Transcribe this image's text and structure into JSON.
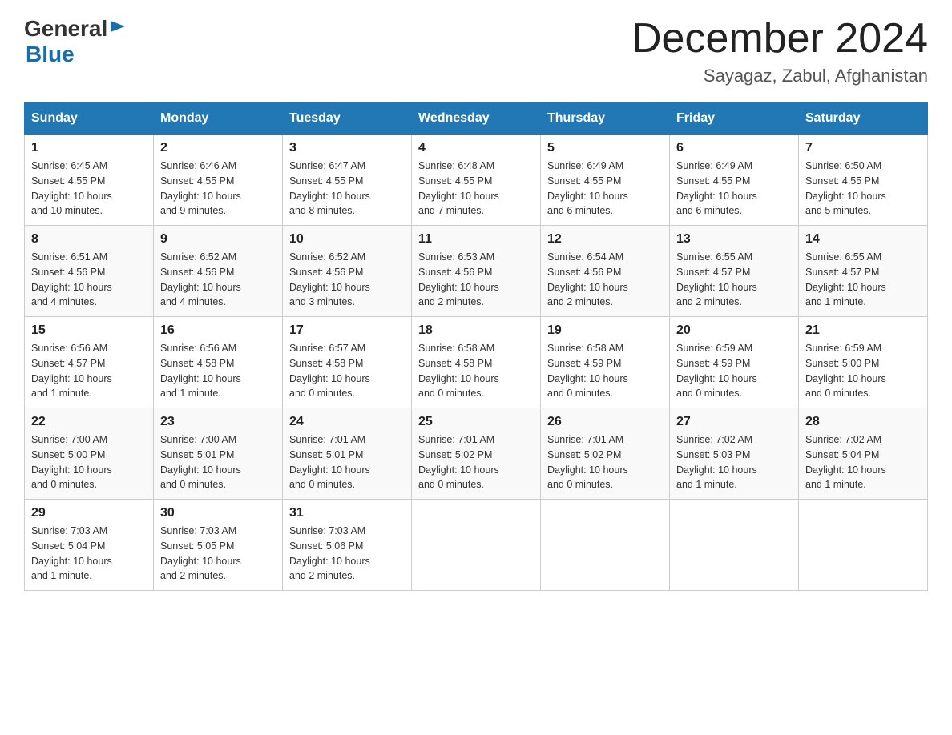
{
  "header": {
    "logo_general": "General",
    "logo_blue": "Blue",
    "month_title": "December 2024",
    "location": "Sayagaz, Zabul, Afghanistan"
  },
  "days_of_week": [
    "Sunday",
    "Monday",
    "Tuesday",
    "Wednesday",
    "Thursday",
    "Friday",
    "Saturday"
  ],
  "weeks": [
    [
      {
        "day": "1",
        "sunrise": "6:45 AM",
        "sunset": "4:55 PM",
        "daylight": "10 hours and 10 minutes."
      },
      {
        "day": "2",
        "sunrise": "6:46 AM",
        "sunset": "4:55 PM",
        "daylight": "10 hours and 9 minutes."
      },
      {
        "day": "3",
        "sunrise": "6:47 AM",
        "sunset": "4:55 PM",
        "daylight": "10 hours and 8 minutes."
      },
      {
        "day": "4",
        "sunrise": "6:48 AM",
        "sunset": "4:55 PM",
        "daylight": "10 hours and 7 minutes."
      },
      {
        "day": "5",
        "sunrise": "6:49 AM",
        "sunset": "4:55 PM",
        "daylight": "10 hours and 6 minutes."
      },
      {
        "day": "6",
        "sunrise": "6:49 AM",
        "sunset": "4:55 PM",
        "daylight": "10 hours and 6 minutes."
      },
      {
        "day": "7",
        "sunrise": "6:50 AM",
        "sunset": "4:55 PM",
        "daylight": "10 hours and 5 minutes."
      }
    ],
    [
      {
        "day": "8",
        "sunrise": "6:51 AM",
        "sunset": "4:56 PM",
        "daylight": "10 hours and 4 minutes."
      },
      {
        "day": "9",
        "sunrise": "6:52 AM",
        "sunset": "4:56 PM",
        "daylight": "10 hours and 4 minutes."
      },
      {
        "day": "10",
        "sunrise": "6:52 AM",
        "sunset": "4:56 PM",
        "daylight": "10 hours and 3 minutes."
      },
      {
        "day": "11",
        "sunrise": "6:53 AM",
        "sunset": "4:56 PM",
        "daylight": "10 hours and 2 minutes."
      },
      {
        "day": "12",
        "sunrise": "6:54 AM",
        "sunset": "4:56 PM",
        "daylight": "10 hours and 2 minutes."
      },
      {
        "day": "13",
        "sunrise": "6:55 AM",
        "sunset": "4:57 PM",
        "daylight": "10 hours and 2 minutes."
      },
      {
        "day": "14",
        "sunrise": "6:55 AM",
        "sunset": "4:57 PM",
        "daylight": "10 hours and 1 minute."
      }
    ],
    [
      {
        "day": "15",
        "sunrise": "6:56 AM",
        "sunset": "4:57 PM",
        "daylight": "10 hours and 1 minute."
      },
      {
        "day": "16",
        "sunrise": "6:56 AM",
        "sunset": "4:58 PM",
        "daylight": "10 hours and 1 minute."
      },
      {
        "day": "17",
        "sunrise": "6:57 AM",
        "sunset": "4:58 PM",
        "daylight": "10 hours and 0 minutes."
      },
      {
        "day": "18",
        "sunrise": "6:58 AM",
        "sunset": "4:58 PM",
        "daylight": "10 hours and 0 minutes."
      },
      {
        "day": "19",
        "sunrise": "6:58 AM",
        "sunset": "4:59 PM",
        "daylight": "10 hours and 0 minutes."
      },
      {
        "day": "20",
        "sunrise": "6:59 AM",
        "sunset": "4:59 PM",
        "daylight": "10 hours and 0 minutes."
      },
      {
        "day": "21",
        "sunrise": "6:59 AM",
        "sunset": "5:00 PM",
        "daylight": "10 hours and 0 minutes."
      }
    ],
    [
      {
        "day": "22",
        "sunrise": "7:00 AM",
        "sunset": "5:00 PM",
        "daylight": "10 hours and 0 minutes."
      },
      {
        "day": "23",
        "sunrise": "7:00 AM",
        "sunset": "5:01 PM",
        "daylight": "10 hours and 0 minutes."
      },
      {
        "day": "24",
        "sunrise": "7:01 AM",
        "sunset": "5:01 PM",
        "daylight": "10 hours and 0 minutes."
      },
      {
        "day": "25",
        "sunrise": "7:01 AM",
        "sunset": "5:02 PM",
        "daylight": "10 hours and 0 minutes."
      },
      {
        "day": "26",
        "sunrise": "7:01 AM",
        "sunset": "5:02 PM",
        "daylight": "10 hours and 0 minutes."
      },
      {
        "day": "27",
        "sunrise": "7:02 AM",
        "sunset": "5:03 PM",
        "daylight": "10 hours and 1 minute."
      },
      {
        "day": "28",
        "sunrise": "7:02 AM",
        "sunset": "5:04 PM",
        "daylight": "10 hours and 1 minute."
      }
    ],
    [
      {
        "day": "29",
        "sunrise": "7:03 AM",
        "sunset": "5:04 PM",
        "daylight": "10 hours and 1 minute."
      },
      {
        "day": "30",
        "sunrise": "7:03 AM",
        "sunset": "5:05 PM",
        "daylight": "10 hours and 2 minutes."
      },
      {
        "day": "31",
        "sunrise": "7:03 AM",
        "sunset": "5:06 PM",
        "daylight": "10 hours and 2 minutes."
      },
      null,
      null,
      null,
      null
    ]
  ],
  "sunrise_label": "Sunrise:",
  "sunset_label": "Sunset:",
  "daylight_label": "Daylight:"
}
